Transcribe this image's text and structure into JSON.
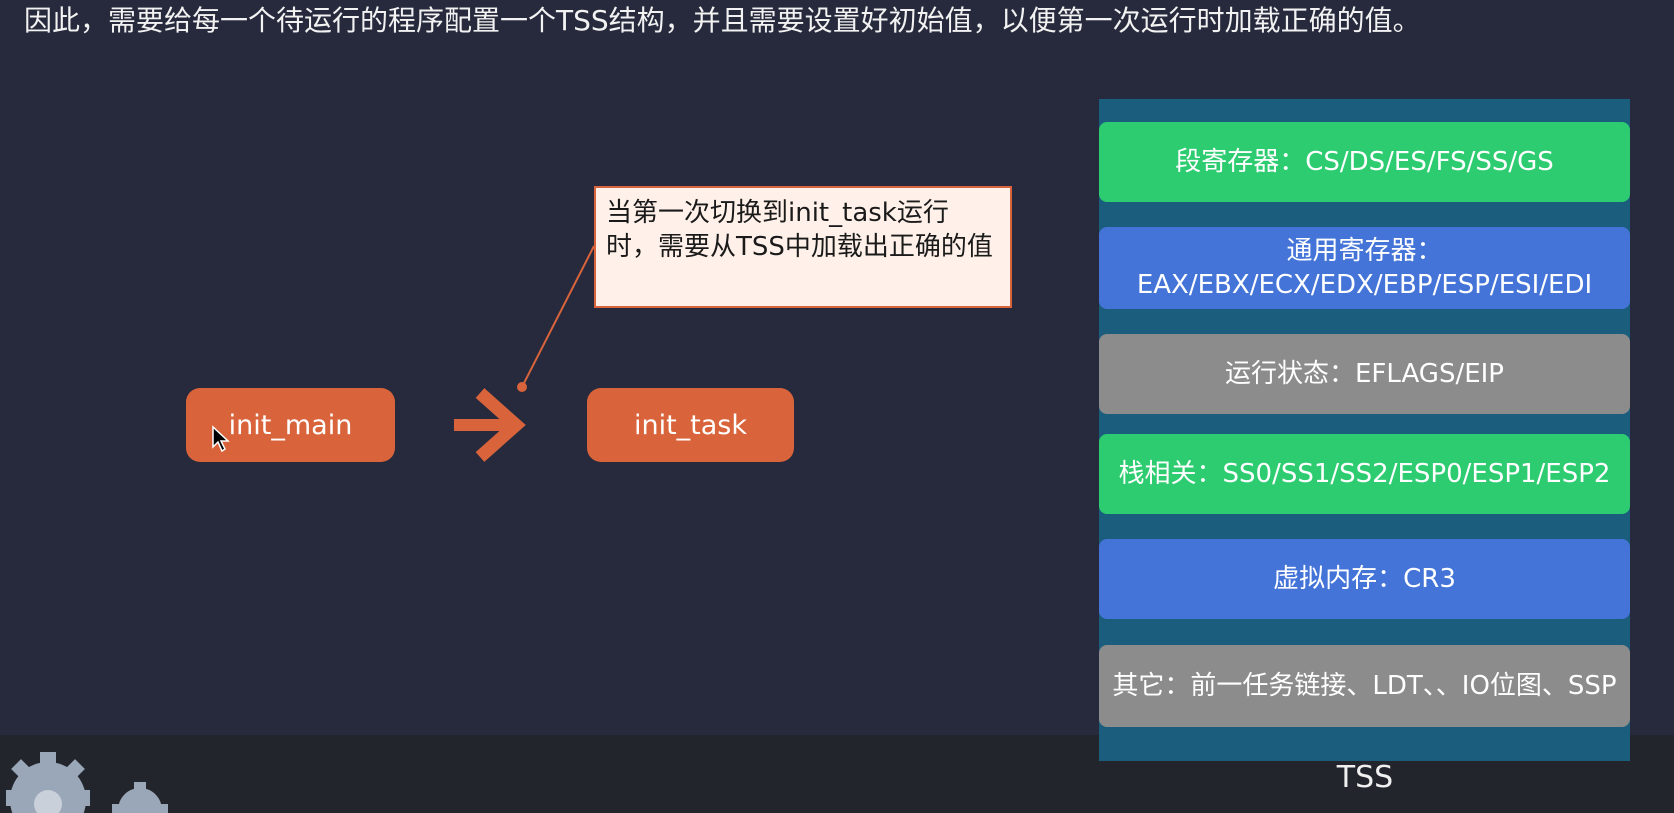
{
  "caption": "因此，需要给每一个待运行的程序配置一个TSS结构，并且需要设置好初始值，以便第一次运行时加载正确的值。",
  "flow": {
    "source_label": "init_main",
    "target_label": "init_task"
  },
  "callout": {
    "text": "当第一次切换到init_task运行时，需要从TSS中加载出正确的值"
  },
  "tss": {
    "label": "TSS",
    "rows": [
      {
        "text": "段寄存器：CS/DS/ES/FS/SS/GS",
        "color": "#2ecc71"
      },
      {
        "text": "通用寄存器：EAX/EBX/ECX/EDX/EBP/ESP/ESI/EDI",
        "color": "#4474d8"
      },
      {
        "text": "运行状态：EFLAGS/EIP",
        "color": "#8c8c8c"
      },
      {
        "text": "栈相关：SS0/SS1/SS2/ESP0/ESP1/ESP2",
        "color": "#2ecc71"
      },
      {
        "text": "虚拟内存：CR3",
        "color": "#4474d8"
      },
      {
        "text": "其它：前一任务链接、LDT、、IO位图、SSP",
        "color": "#8c8c8c"
      }
    ]
  },
  "colors": {
    "background": "#262a3c",
    "node": "#d9643b",
    "callout_bg": "#fff1ea",
    "tss_panel": "#1a5d7c"
  }
}
